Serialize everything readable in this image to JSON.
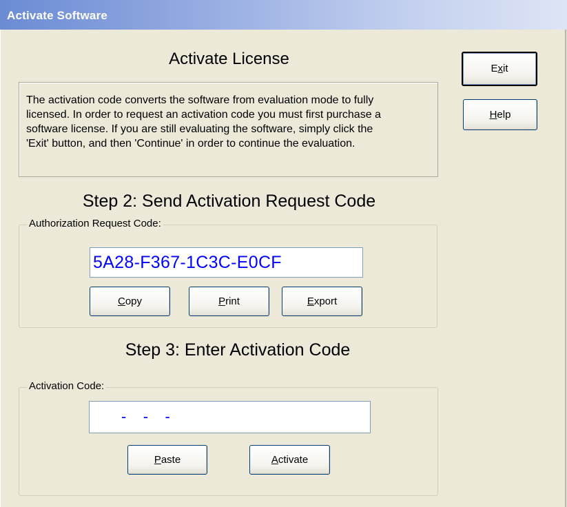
{
  "window": {
    "title": "Activate Software"
  },
  "main": {
    "heading": "Activate License",
    "info_lines": [
      "The activation code converts the software from evaluation mode to fully",
      "licensed.  In order to request an activation code you must first purchase a",
      "software license.  If you are still evaluating the software, simply click the",
      "'Exit' button, and then 'Continue' in order to continue the evaluation."
    ]
  },
  "step2": {
    "heading": "Step 2: Send Activation Request Code",
    "group_label": "Authorization Request Code:",
    "request_code": "5A28-F367-1C3C-E0CF",
    "buttons": {
      "copy": {
        "pre": "",
        "key": "C",
        "post": "opy"
      },
      "print": {
        "pre": "",
        "key": "P",
        "post": "rint"
      },
      "export": {
        "pre": "",
        "key": "E",
        "post": "xport"
      }
    }
  },
  "step3": {
    "heading": "Step 3: Enter Activation Code",
    "group_label": "Activation Code:",
    "activation_code": "-    -    -",
    "buttons": {
      "paste": {
        "pre": "",
        "key": "P",
        "post": "aste"
      },
      "activate": {
        "pre": "",
        "key": "A",
        "post": "ctivate"
      }
    }
  },
  "side_buttons": {
    "exit": {
      "pre": "E",
      "key": "x",
      "post": "it"
    },
    "help": {
      "pre": "",
      "key": "H",
      "post": "elp"
    }
  },
  "colors": {
    "dialog_bg": "#ECE9D8",
    "code_text": "#0000FF"
  }
}
